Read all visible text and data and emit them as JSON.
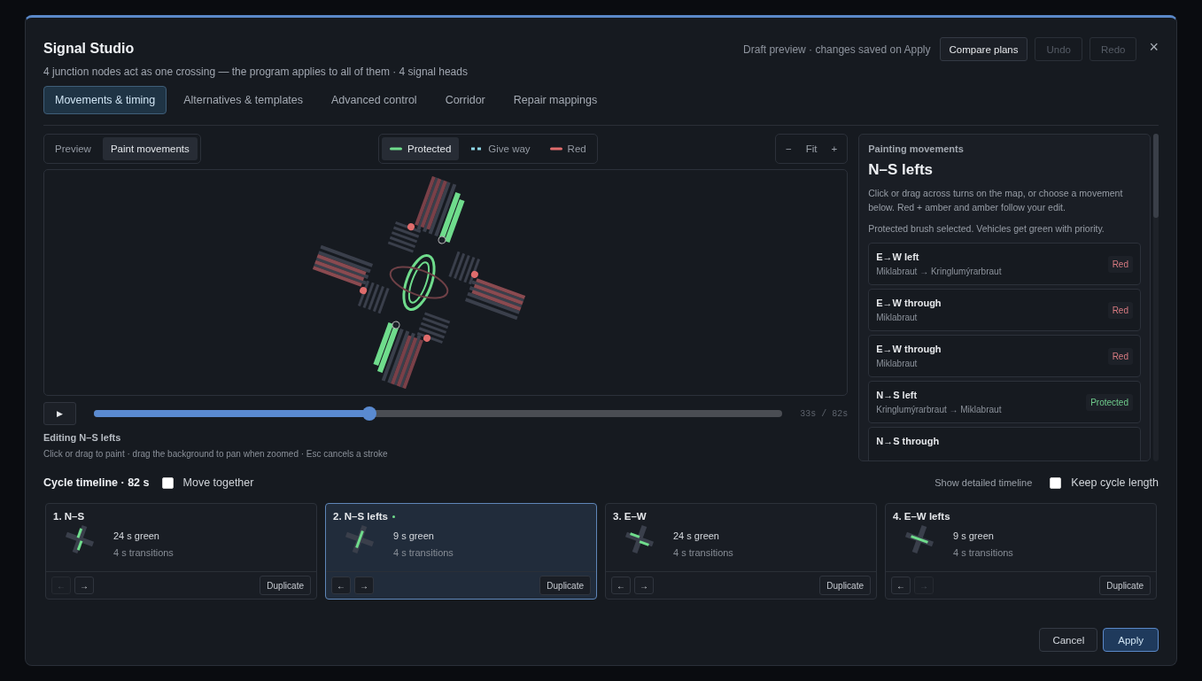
{
  "window": {
    "title": "Signal Studio",
    "subtitle": "4 junction nodes act as one crossing — the program applies to all of them · 4 signal heads",
    "draft_note": "Draft preview · changes saved on Apply"
  },
  "header_buttons": [
    {
      "label": "Compare plans",
      "disabled": false
    },
    {
      "label": "Undo",
      "disabled": true
    },
    {
      "label": "Redo",
      "disabled": true
    }
  ],
  "tabs": [
    {
      "label": "Movements & timing",
      "selected": true
    },
    {
      "label": "Alternatives & templates",
      "selected": false
    },
    {
      "label": "Advanced control",
      "selected": false
    },
    {
      "label": "Corridor",
      "selected": false
    },
    {
      "label": "Repair mappings",
      "selected": false
    }
  ],
  "view_modes": [
    {
      "label": "Preview",
      "selected": false
    },
    {
      "label": "Paint movements",
      "selected": true
    }
  ],
  "brushes": [
    {
      "label": "Protected",
      "selected": true,
      "color": "#6fdc8c",
      "kind": "solid"
    },
    {
      "label": "Give way",
      "selected": false,
      "color": "#8fd8e8",
      "kind": "dashed"
    },
    {
      "label": "Red",
      "selected": false,
      "color": "#e06c6c",
      "kind": "solid"
    }
  ],
  "zoom": {
    "minus": "−",
    "fit": "Fit",
    "plus": "+"
  },
  "playback": {
    "play": "▶",
    "level": 0.4,
    "reading": "33s / 82s"
  },
  "editing": {
    "title": "Editing N–S lefts",
    "hint": "Click or drag to paint · drag the background to pan when zoomed · Esc cancels a stroke"
  },
  "panel": {
    "eyebrow": "Painting movements",
    "title": "N–S lefts",
    "intro": "Click or drag across turns on the map, or choose a movement below. Red + amber and amber follow your edit.",
    "brush_note": "Protected brush selected. Vehicles get green with priority.",
    "movements": [
      {
        "name": "E→W left",
        "route": "Miklabraut → Kringlumýrarbraut",
        "status": "Red",
        "kind": "red"
      },
      {
        "name": "E→W through",
        "route": "Miklabraut",
        "status": "Red",
        "kind": "red"
      },
      {
        "name": "E→W through",
        "route": "Miklabraut",
        "status": "Red",
        "kind": "red"
      },
      {
        "name": "N→S left",
        "route": "Kringlumýrarbraut → Miklabraut",
        "status": "Protected",
        "kind": "protected"
      },
      {
        "name": "N→S through"
      }
    ]
  },
  "cycle": {
    "title": "Cycle timeline · 82 s",
    "move_together": {
      "label": "Move together",
      "checked": false
    },
    "detailed_link": "Show detailed timeline",
    "keep_length": {
      "label": "Keep cycle length",
      "checked": false
    }
  },
  "phases": [
    {
      "title": "1. N–S",
      "green": "24 s green",
      "transitions": "4 s transitions",
      "selected": false,
      "edited": false,
      "kind": "ns",
      "prev_disabled": true,
      "next_disabled": false,
      "duplicate": "Duplicate",
      "prev": "←",
      "next": "→"
    },
    {
      "title": "2. N–S lefts",
      "green": "9 s green",
      "transitions": "4 s transitions",
      "selected": true,
      "edited": true,
      "kind": "nsl",
      "prev_disabled": false,
      "next_disabled": false,
      "duplicate": "Duplicate",
      "prev": "←",
      "next": "→"
    },
    {
      "title": "3. E–W",
      "green": "24 s green",
      "transitions": "4 s transitions",
      "selected": false,
      "edited": false,
      "kind": "ew",
      "prev_disabled": false,
      "next_disabled": false,
      "duplicate": "Duplicate",
      "prev": "←",
      "next": "→"
    },
    {
      "title": "4. E–W lefts",
      "green": "9 s green",
      "transitions": "4 s transitions",
      "selected": false,
      "edited": false,
      "kind": "ewl",
      "prev_disabled": false,
      "next_disabled": true,
      "duplicate": "Duplicate",
      "prev": "←",
      "next": "→"
    }
  ],
  "footer": {
    "cancel": "Cancel",
    "apply": "Apply"
  },
  "close": "×"
}
